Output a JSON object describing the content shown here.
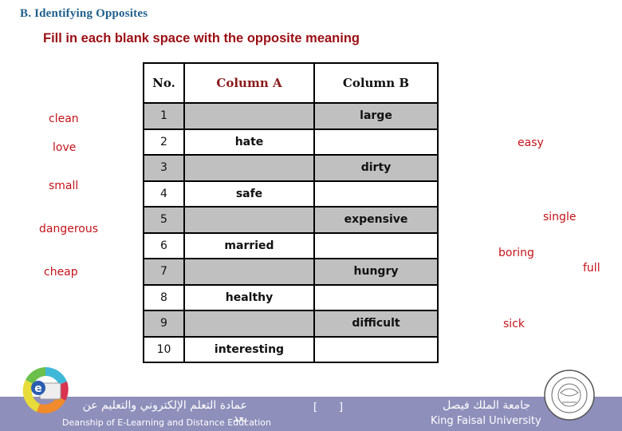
{
  "section_title": "B. Identifying Opposites",
  "instruction": "Fill in each blank space with the opposite meaning",
  "table": {
    "headers": [
      "No.",
      "Column A",
      "Column B"
    ],
    "rows": [
      {
        "no": "1",
        "a": "",
        "b": "large"
      },
      {
        "no": "2",
        "a": "hate",
        "b": ""
      },
      {
        "no": "3",
        "a": "",
        "b": "dirty"
      },
      {
        "no": "4",
        "a": "safe",
        "b": ""
      },
      {
        "no": "5",
        "a": "",
        "b": "expensive"
      },
      {
        "no": "6",
        "a": "married",
        "b": ""
      },
      {
        "no": "7",
        "a": "",
        "b": "hungry"
      },
      {
        "no": "8",
        "a": "healthy",
        "b": ""
      },
      {
        "no": "9",
        "a": "",
        "b": "difficult"
      },
      {
        "no": "10",
        "a": "interesting",
        "b": ""
      }
    ]
  },
  "answer_words_left": [
    "clean",
    "love",
    "small",
    "dangerous",
    "cheap"
  ],
  "answer_words_right": [
    "easy",
    "single",
    "boring",
    "full",
    "sick"
  ],
  "footer": {
    "deanship_arabic": "عمادة التعلم الإلكتروني والتعليم عن بعد",
    "deanship_english": "Deanship of E-Learning and Distance Education",
    "bracket_left": "[",
    "bracket_right": "]",
    "university_arabic": "جامعة الملك فيصل",
    "university_english": "King Faisal University"
  },
  "colors": {
    "title": "#1f5f8b",
    "instruction": "#9b0e14",
    "answer_words": "#c4121a",
    "shaded_row": "#c0c0c0",
    "footer_bar": "#8f8fbc"
  }
}
